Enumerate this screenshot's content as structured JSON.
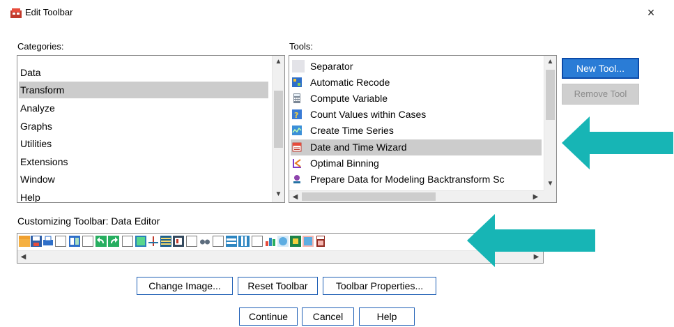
{
  "window": {
    "title": "Edit Toolbar",
    "close_glyph": "×"
  },
  "categories": {
    "label": "Categories:",
    "items": [
      "Data",
      "Transform",
      "Analyze",
      "Graphs",
      "Utilities",
      "Extensions",
      "Window",
      "Help"
    ],
    "selected": "Transform"
  },
  "tools": {
    "label": "Tools:",
    "items": [
      {
        "label": "Separator",
        "icon": "separator-icon"
      },
      {
        "label": "Automatic Recode",
        "icon": "automatic-recode-icon"
      },
      {
        "label": "Compute Variable",
        "icon": "calculator-icon"
      },
      {
        "label": "Count Values within Cases",
        "icon": "count-values-icon"
      },
      {
        "label": "Create Time Series",
        "icon": "time-series-icon"
      },
      {
        "label": "Date and Time Wizard",
        "icon": "calendar-icon"
      },
      {
        "label": "Optimal Binning",
        "icon": "binning-icon"
      },
      {
        "label": "Prepare Data for Modeling Backtransform Sc",
        "icon": "prepare-data-icon"
      }
    ],
    "selected": "Date and Time Wizard"
  },
  "side_buttons": {
    "new_tool": "New Tool...",
    "remove_tool": "Remove Tool"
  },
  "customizing": {
    "label": "Customizing Toolbar:  Data Editor"
  },
  "bottom_buttons": {
    "change_image": "Change Image...",
    "reset_toolbar": "Reset Toolbar",
    "toolbar_properties": "Toolbar Properties...",
    "continue": "Continue",
    "cancel": "Cancel",
    "help": "Help"
  },
  "colors": {
    "accent": "#2a7cd6",
    "arrow": "#17b5b5",
    "selection": "#cccccc"
  }
}
